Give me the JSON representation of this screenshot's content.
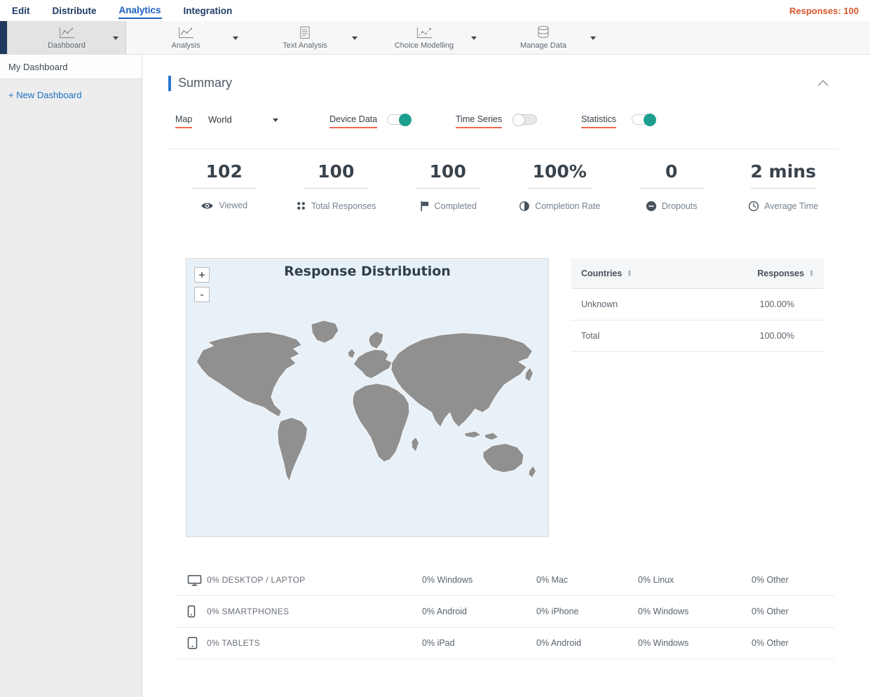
{
  "top_nav": {
    "items": [
      {
        "label": "Edit"
      },
      {
        "label": "Distribute"
      },
      {
        "label": "Analytics"
      },
      {
        "label": "Integration"
      }
    ],
    "responses": "Responses: 100"
  },
  "toolbar": {
    "items": [
      {
        "label": "Dashboard",
        "icon": "line-chart-icon",
        "selected": true
      },
      {
        "label": "Analysis",
        "icon": "line-chart-icon",
        "selected": false
      },
      {
        "label": "Text Analysis",
        "icon": "document-icon",
        "selected": false
      },
      {
        "label": "Choice Modelling",
        "icon": "scatter-chart-icon",
        "selected": false
      },
      {
        "label": "Manage Data",
        "icon": "database-icon",
        "selected": false
      }
    ]
  },
  "sidebar": {
    "my_dashboard": "My Dashboard",
    "new_dashboard": "+ New Dashboard"
  },
  "summary": {
    "title": "Summary",
    "controls": {
      "map_label": "Map",
      "map_value": "World",
      "device_data_label": "Device Data",
      "device_data_on": true,
      "time_series_label": "Time Series",
      "time_series_on": false,
      "statistics_label": "Statistics",
      "statistics_on": true
    },
    "stats": [
      {
        "value": "102",
        "label": "Viewed",
        "icon": "eye-icon"
      },
      {
        "value": "100",
        "label": "Total Responses",
        "icon": "dot-grid-icon"
      },
      {
        "value": "100",
        "label": "Completed",
        "icon": "flag-icon"
      },
      {
        "value": "100%",
        "label": "Completion Rate",
        "icon": "half-circle-icon"
      },
      {
        "value": "0",
        "label": "Dropouts",
        "icon": "minus-circle-icon"
      },
      {
        "value": "2 mins",
        "label": "Average Time",
        "icon": "clock-icon"
      }
    ],
    "map": {
      "title": "Response Distribution",
      "zoom_in_label": "+",
      "zoom_out_label": "-"
    },
    "countries_table": {
      "country_header": "Countries",
      "responses_header": "Responses",
      "rows": [
        {
          "country": "Unknown",
          "responses": "100.00%"
        },
        {
          "country": "Total",
          "responses": "100.00%"
        }
      ]
    },
    "device_table": {
      "rows": [
        {
          "icon": "desktop-icon",
          "label": "0% DESKTOP / LAPTOP",
          "cols": [
            "0% Windows",
            "0% Mac",
            "0% Linux",
            "0% Other"
          ]
        },
        {
          "icon": "smartphone-icon",
          "label": "0% SMARTPHONES",
          "cols": [
            "0% Android",
            "0% iPhone",
            "0% Windows",
            "0% Other"
          ]
        },
        {
          "icon": "tablet-icon",
          "label": "0% TABLETS",
          "cols": [
            "0% iPad",
            "0% Android",
            "0% Windows",
            "0% Other"
          ]
        }
      ]
    }
  },
  "colors": {
    "accent_blue": "#2a79d0",
    "nav_active_blue": "#1b5fc2",
    "toggle_on_teal": "#1d9e8f",
    "underline_red": "#e96a54",
    "responses_orange": "#d8572b",
    "map_land_gray": "#909090",
    "map_bg_blue": "#e9f1f8"
  }
}
